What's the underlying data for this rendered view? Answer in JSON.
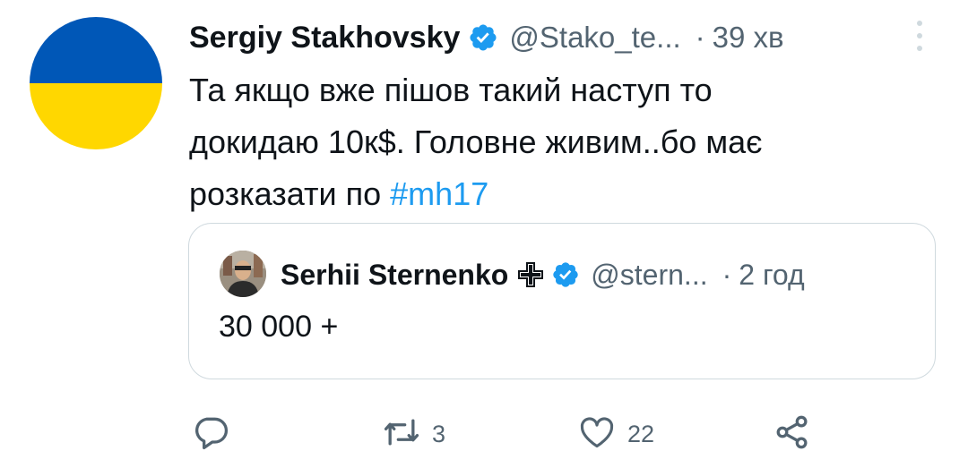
{
  "tweet": {
    "author_name": "Sergiy Stakhovsky",
    "handle": "@Stako_te...",
    "dot": "·",
    "time": "39 хв",
    "text_lines": [
      "Та якщо вже пішов такий наступ то",
      "докидаю 10к$. Головне живим..бо має",
      "розказати по "
    ],
    "hashtag": "#mh17",
    "avatar_colors": {
      "top": "#0057b7",
      "bottom": "#ffd700"
    }
  },
  "quoted": {
    "author_name": "Serhii Sternenko",
    "handle": "@stern...",
    "dot": "·",
    "time": "2 год",
    "text": "30 000 +"
  },
  "actions": {
    "reply_icon": "reply-icon",
    "retweet_count": "3",
    "like_count": "22",
    "share_icon": "share-icon"
  },
  "colors": {
    "accent": "#1d9bf0",
    "secondary_text": "#536471",
    "border": "#cfd9de"
  }
}
